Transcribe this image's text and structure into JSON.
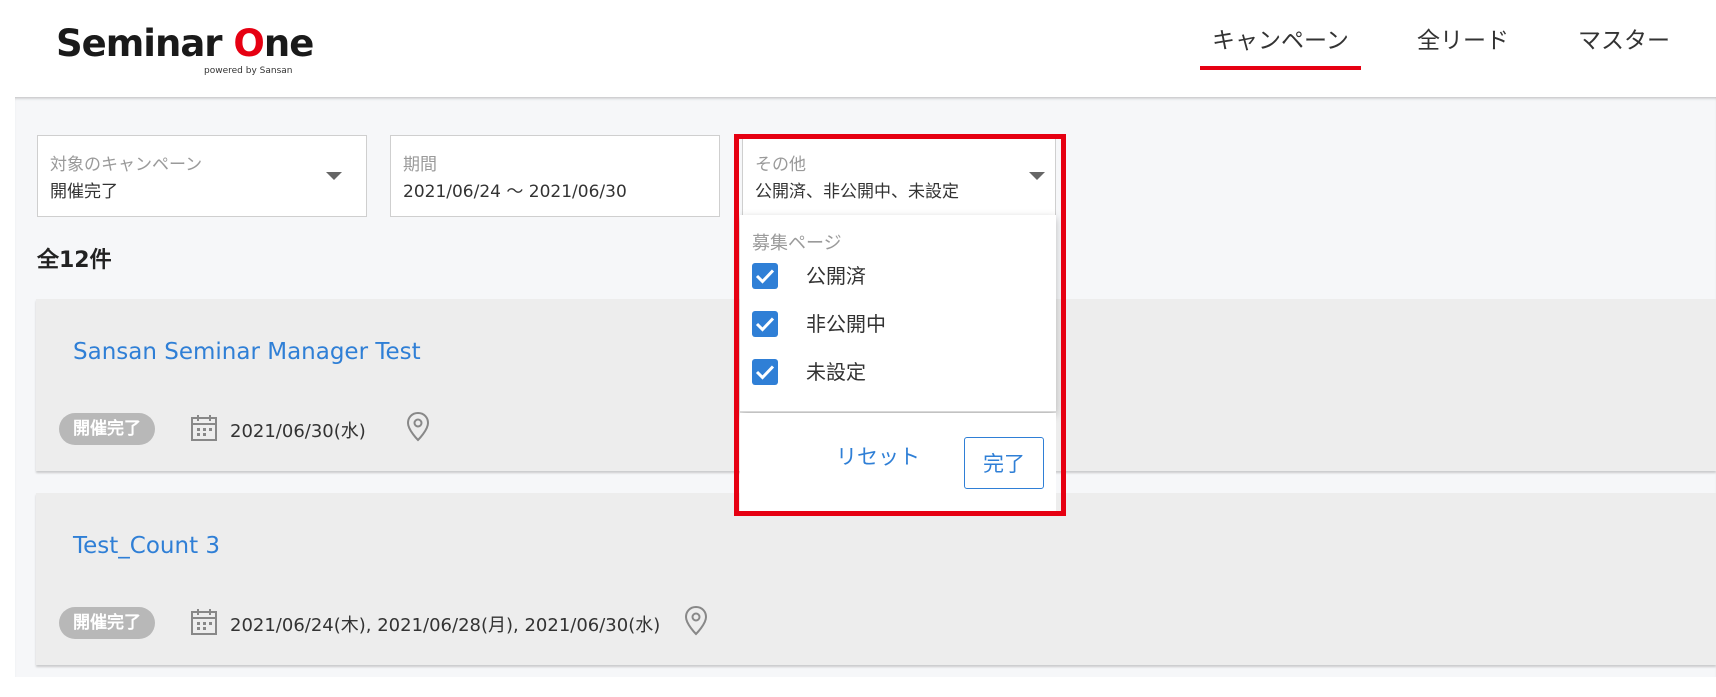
{
  "header": {
    "logo_text_a": "Seminar ",
    "logo_text_b": "O",
    "logo_text_c": "ne",
    "logo_sub": "powered by Sansan",
    "nav": [
      {
        "label": "キャンペーン",
        "active": true
      },
      {
        "label": "全リード",
        "active": false
      },
      {
        "label": "マスター",
        "active": false
      }
    ]
  },
  "filters": {
    "campaign": {
      "label": "対象のキャンペーン",
      "value": "開催完了"
    },
    "period": {
      "label": "期間",
      "value": "2021/06/24 ～ 2021/06/30"
    },
    "other": {
      "label": "その他",
      "value": "公開済、非公開中、未設定"
    }
  },
  "count_text": "全12件",
  "cards": [
    {
      "title": "Sansan Seminar Manager Test",
      "status": "開催完了",
      "dates": "2021/06/30(水)"
    },
    {
      "title": "Test_Count 3",
      "status": "開催完了",
      "dates": "2021/06/24(木), 2021/06/28(月), 2021/06/30(水)"
    }
  ],
  "dropdown": {
    "group_label": "募集ページ",
    "options": [
      {
        "label": "公開済",
        "checked": true
      },
      {
        "label": "非公開中",
        "checked": true
      },
      {
        "label": "未設定",
        "checked": true
      }
    ],
    "reset_label": "リセット",
    "done_label": "完了"
  },
  "colors": {
    "accent_red": "#e60012",
    "link_blue": "#2f7fd6",
    "badge_gray": "#b8b8b8",
    "card_bg": "#ededed"
  }
}
